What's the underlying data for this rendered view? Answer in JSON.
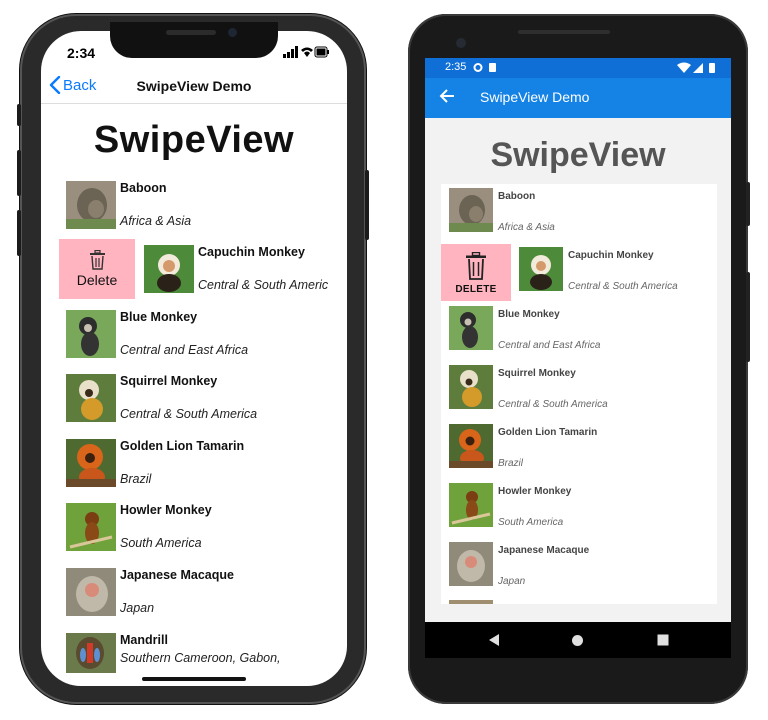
{
  "ios": {
    "status_time": "2:34",
    "nav": {
      "back_label": "Back",
      "title": "SwipeView Demo"
    },
    "heading": "SwipeView",
    "swipe_delete_label": "Delete",
    "items": [
      {
        "name": "Baboon",
        "location": "Africa & Asia"
      },
      {
        "name": "Capuchin Monkey",
        "location": "Central & South Americ"
      },
      {
        "name": "Blue Monkey",
        "location": "Central and East Africa"
      },
      {
        "name": "Squirrel Monkey",
        "location": "Central & South America"
      },
      {
        "name": "Golden Lion Tamarin",
        "location": "Brazil"
      },
      {
        "name": "Howler Monkey",
        "location": "South America"
      },
      {
        "name": "Japanese Macaque",
        "location": "Japan"
      },
      {
        "name": "Mandrill",
        "location": "Southern Cameroon, Gabon,"
      }
    ]
  },
  "android": {
    "status_time": "2:35",
    "appbar_title": "SwipeView Demo",
    "heading": "SwipeView",
    "swipe_delete_label": "DELETE",
    "items": [
      {
        "name": "Baboon",
        "location": "Africa & Asia"
      },
      {
        "name": "Capuchin Monkey",
        "location": "Central & South America"
      },
      {
        "name": "Blue Monkey",
        "location": "Central and East Africa"
      },
      {
        "name": "Squirrel Monkey",
        "location": "Central & South America"
      },
      {
        "name": "Golden Lion Tamarin",
        "location": "Brazil"
      },
      {
        "name": "Howler Monkey",
        "location": "South America"
      },
      {
        "name": "Japanese Macaque",
        "location": "Japan"
      }
    ]
  },
  "colors": {
    "ios_accent": "#0a7aff",
    "android_appbar": "#1582e6",
    "android_statusbar": "#0f6fd6",
    "delete_background": "#ffb4c0"
  }
}
